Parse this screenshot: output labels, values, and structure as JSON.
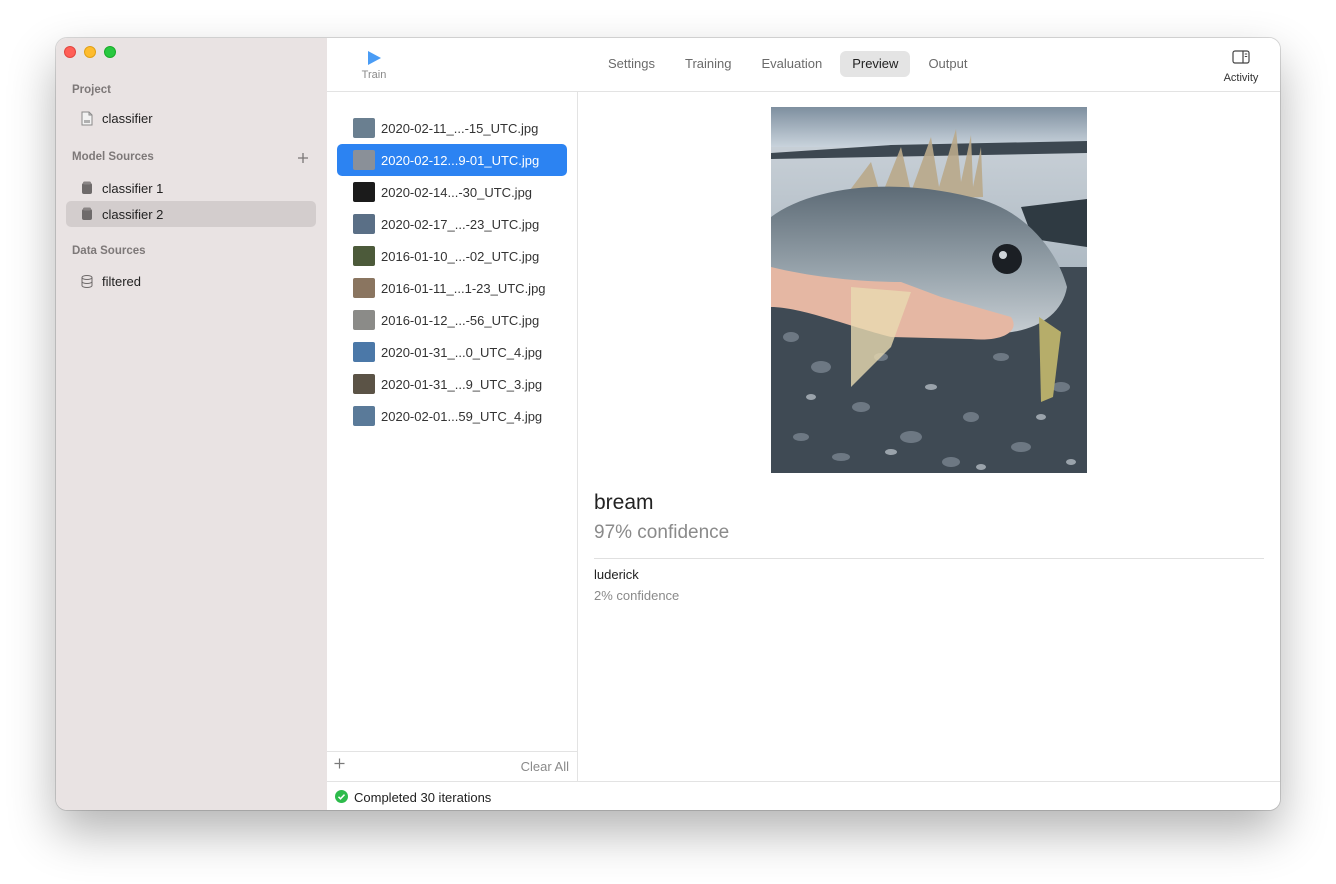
{
  "sidebar": {
    "project_header": "Project",
    "project_item": "classifier",
    "model_sources_header": "Model Sources",
    "model_sources": [
      {
        "label": "classifier 1",
        "selected": false
      },
      {
        "label": "classifier 2",
        "selected": true
      }
    ],
    "data_sources_header": "Data Sources",
    "data_sources": [
      {
        "label": "filtered"
      }
    ],
    "add_icon": "plus-icon"
  },
  "toolbar": {
    "train_label": "Train",
    "tabs": [
      "Settings",
      "Training",
      "Evaluation",
      "Preview",
      "Output"
    ],
    "active_tab": "Preview",
    "activity_label": "Activity"
  },
  "files": [
    {
      "name": "2020-02-11_...-15_UTC.jpg",
      "selected": false,
      "thumb_color": "#6a7f90"
    },
    {
      "name": "2020-02-12...9-01_UTC.jpg",
      "selected": true,
      "thumb_color": "#8a9098"
    },
    {
      "name": "2020-02-14...-30_UTC.jpg",
      "selected": false,
      "thumb_color": "#1b1b1b"
    },
    {
      "name": "2020-02-17_...-23_UTC.jpg",
      "selected": false,
      "thumb_color": "#5a6f86"
    },
    {
      "name": "2016-01-10_...-02_UTC.jpg",
      "selected": false,
      "thumb_color": "#4c5a3a"
    },
    {
      "name": "2016-01-11_...1-23_UTC.jpg",
      "selected": false,
      "thumb_color": "#8a7560"
    },
    {
      "name": "2016-01-12_...-56_UTC.jpg",
      "selected": false,
      "thumb_color": "#8b8b88"
    },
    {
      "name": "2020-01-31_...0_UTC_4.jpg",
      "selected": false,
      "thumb_color": "#4b78a8"
    },
    {
      "name": "2020-01-31_...9_UTC_3.jpg",
      "selected": false,
      "thumb_color": "#5b5346"
    },
    {
      "name": "2020-02-01...59_UTC_4.jpg",
      "selected": false,
      "thumb_color": "#5a7a99"
    }
  ],
  "list_footer": {
    "clear_all": "Clear All"
  },
  "preview": {
    "top_label": "bream",
    "top_confidence": "97% confidence",
    "second_label": "luderick",
    "second_confidence": "2% confidence"
  },
  "status": {
    "text": "Completed 30 iterations",
    "color": "#2dbb4b"
  },
  "colors": {
    "accent": "#2c83f2",
    "sidebar_bg": "#e9e3e3"
  }
}
